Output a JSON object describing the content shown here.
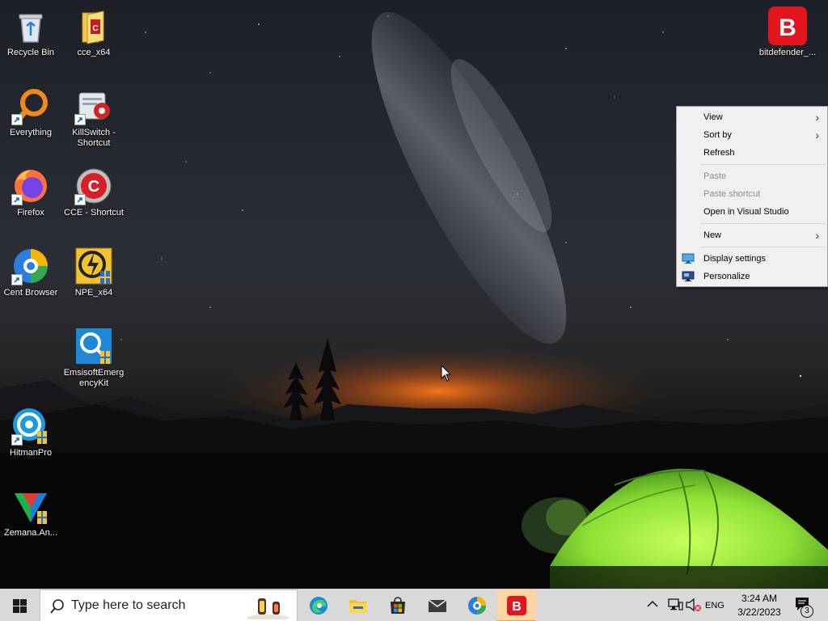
{
  "desktop": {
    "icons": [
      {
        "label": "Recycle Bin"
      },
      {
        "label": "cce_x64"
      },
      {
        "label": "Everything"
      },
      {
        "label": "KillSwitch - Shortcut"
      },
      {
        "label": "Firefox"
      },
      {
        "label": "CCE - Shortcut"
      },
      {
        "label": "Cent Browser"
      },
      {
        "label": "NPE_x64"
      },
      {
        "label": "EmsisoftEmergencyKit"
      },
      {
        "label": "HitmanPro"
      },
      {
        "label": "Zemana.An..."
      },
      {
        "label": "bitdefender_..."
      }
    ]
  },
  "context_menu": {
    "items": [
      {
        "label": "View",
        "submenu": true,
        "enabled": true
      },
      {
        "label": "Sort by",
        "submenu": true,
        "enabled": true
      },
      {
        "label": "Refresh",
        "enabled": true
      },
      {
        "label": "Paste",
        "enabled": false
      },
      {
        "label": "Paste shortcut",
        "enabled": false
      },
      {
        "label": "Open in Visual Studio",
        "enabled": true
      },
      {
        "label": "New",
        "submenu": true,
        "enabled": true
      },
      {
        "label": "Display settings",
        "icon": "display-settings-icon",
        "enabled": true
      },
      {
        "label": "Personalize",
        "icon": "personalize-icon",
        "enabled": true
      }
    ],
    "chevron": "›"
  },
  "taskbar": {
    "search_placeholder": "Type here to search",
    "apps": [
      {
        "name": "Microsoft Edge",
        "icon": "edge-icon"
      },
      {
        "name": "File Explorer",
        "icon": "file-explorer-icon"
      },
      {
        "name": "Microsoft Store",
        "icon": "store-icon"
      },
      {
        "name": "Mail",
        "icon": "mail-icon"
      },
      {
        "name": "Cent Browser",
        "icon": "cent-browser-icon"
      },
      {
        "name": "Bitdefender",
        "icon": "bitdefender-icon",
        "active": true
      }
    ],
    "tray": {
      "language": "ENG",
      "time": "3:24 AM",
      "date": "3/22/2023",
      "notification_count": "3"
    }
  },
  "colors": {
    "taskbar_bg": "#d9d9d9",
    "menu_bg": "#f0f0f0",
    "bitdefender_red": "#e2141d",
    "tent_green": "#8ee23a",
    "active_app_bg": "#ffd5a6"
  }
}
